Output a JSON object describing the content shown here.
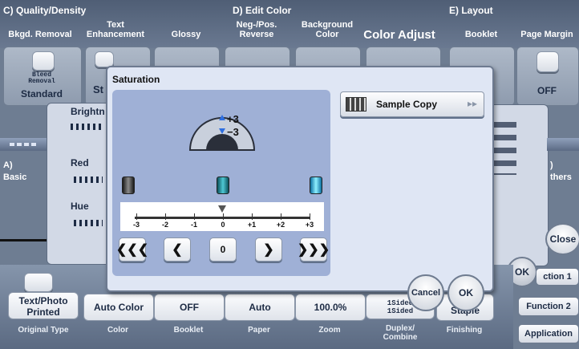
{
  "sections": {
    "quality": "C)  Quality/Density",
    "edit_color": "D)  Edit Color",
    "layout": "E)  Layout"
  },
  "top_tabs": {
    "bkgd_removal": "Bkgd. Removal",
    "text_enh_1": "Text",
    "text_enh_2": "Enhancement",
    "glossy": "Glossy",
    "negpos_1": "Neg-/Pos.",
    "negpos_2": "Reverse",
    "bgcolor_1": "Background",
    "bgcolor_2": "Color",
    "color_adjust": "Color Adjust",
    "booklet": "Booklet",
    "page_margin": "Page Margin"
  },
  "background_tiles": {
    "bleed_1": "Bleed",
    "bleed_2": "Removal",
    "standard": "Standard",
    "st": "St",
    "off": "OFF"
  },
  "left_nav": {
    "basic_letter": "A)",
    "basic": "Basic",
    "others_letter": ")",
    "others": "thers"
  },
  "behind_panel": {
    "brightness": "Brightn",
    "red": "Red",
    "hue": "Hue"
  },
  "bottom_bar": {
    "items": [
      {
        "value_1": "Text/Photo",
        "value_2": "Printed",
        "label": "Original Type"
      },
      {
        "value_1": "Auto Color",
        "value_2": "",
        "label": "Color"
      },
      {
        "value_1": "OFF",
        "value_2": "",
        "label": "Booklet"
      },
      {
        "value_1": "Auto",
        "value_2": "",
        "label": "Paper"
      },
      {
        "value_1": "100.0%",
        "value_2": "",
        "label": "Zoom"
      },
      {
        "value_1": "1Sided",
        "value_2": "1Sided",
        "label_1": "Duplex/",
        "label_2": "Combine"
      },
      {
        "value_1": "Staple",
        "value_2": "",
        "label": "Finishing"
      }
    ]
  },
  "right_buttons": {
    "close": "Close",
    "function1": "ction 1",
    "function2": "Function 2",
    "application": "Application",
    "ok_back": "OK"
  },
  "dialog": {
    "title": "Saturation",
    "indicator_plus": "+3",
    "indicator_minus": "−3",
    "scale": [
      "-3",
      "-2",
      "-1",
      "0",
      "+1",
      "+2",
      "+3"
    ],
    "current_value": "0",
    "sample_copy": "Sample Copy",
    "cancel": "Cancel",
    "ok": "OK"
  },
  "colors": {
    "background": "#6e7d92",
    "dialog": "#dfe6f4",
    "dialog_panel": "#9fb0d6",
    "accent_blue": "#2c4a8c"
  }
}
